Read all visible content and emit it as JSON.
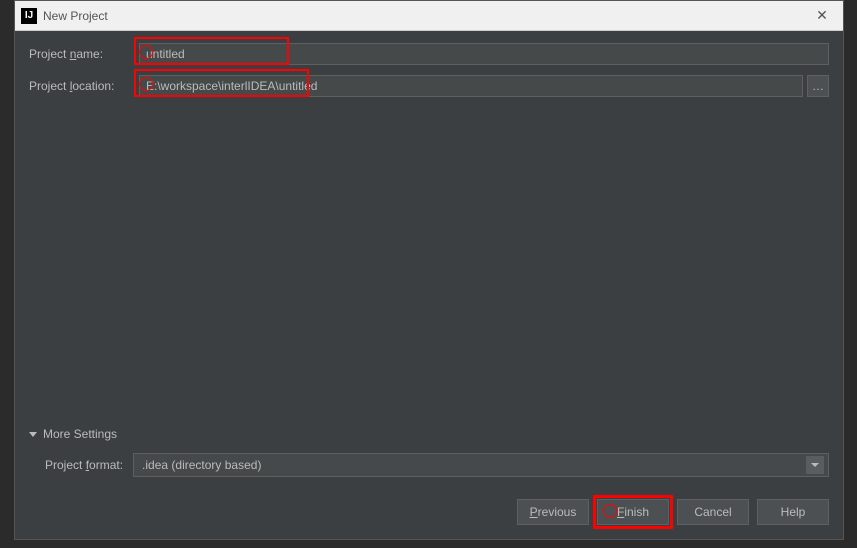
{
  "titlebar": {
    "app_icon_text": "IJ",
    "title": "New Project",
    "close_glyph": "✕"
  },
  "form": {
    "name_label_pre": "Project ",
    "name_label_mnemonic": "n",
    "name_label_post": "ame:",
    "name_value": "untitled",
    "location_label_pre": "Project ",
    "location_label_mnemonic": "l",
    "location_label_post": "ocation:",
    "location_value": "E:\\workspace\\interlIDEA\\untitled",
    "browse_glyph": "…"
  },
  "more_settings": {
    "header_label": "More Settings",
    "format_label_pre": "Project ",
    "format_label_mnemonic": "f",
    "format_label_post": "ormat:",
    "format_value": ".idea (directory based)"
  },
  "buttons": {
    "previous_mnemonic": "P",
    "previous_rest": "revious",
    "finish_mnemonic": "F",
    "finish_rest": "inish",
    "cancel": "Cancel",
    "help": "Help"
  }
}
